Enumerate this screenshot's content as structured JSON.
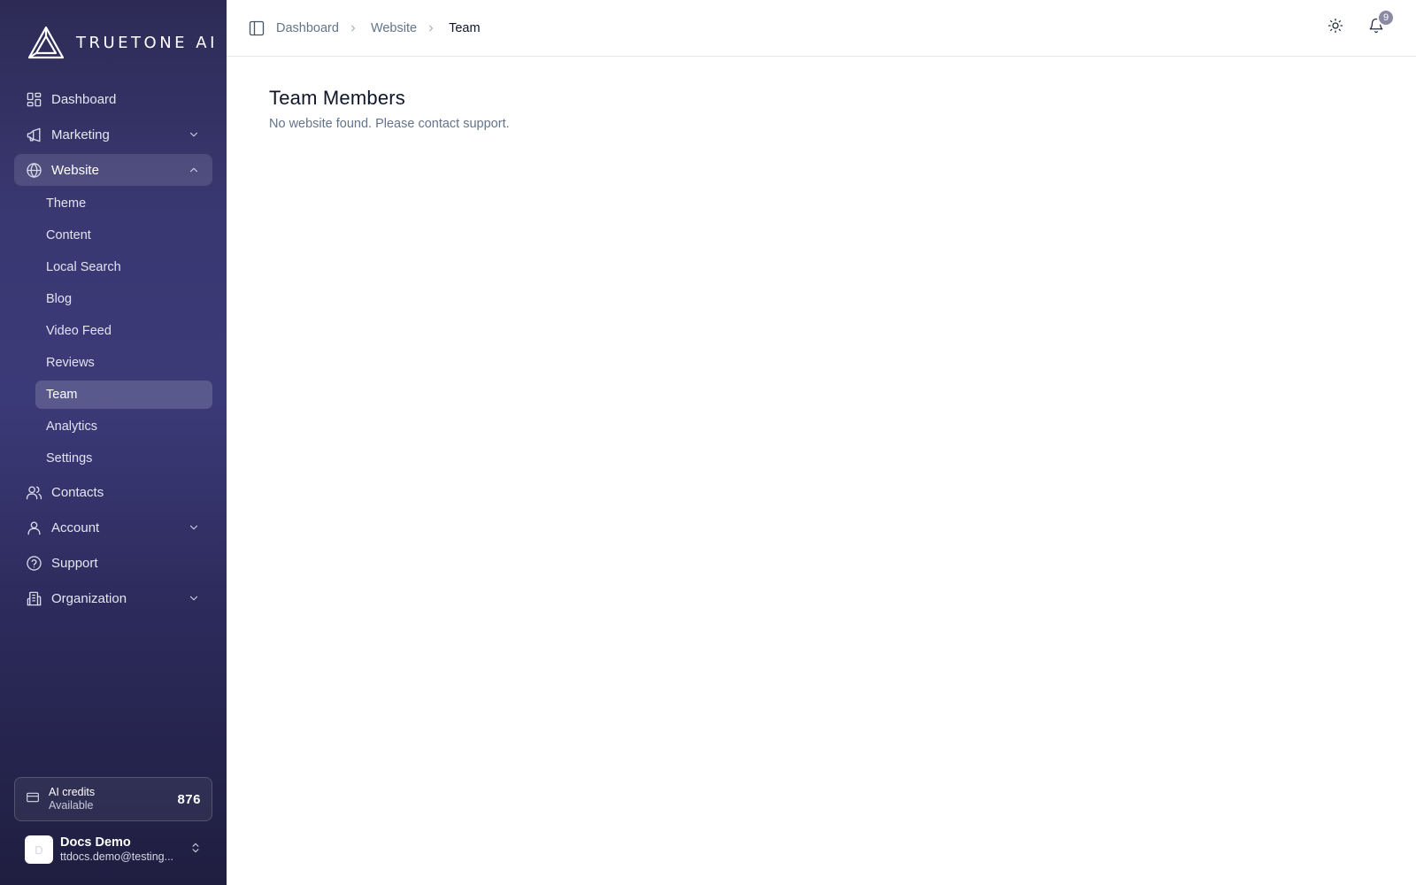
{
  "brand": {
    "name": "TRUETONE AI",
    "logo_icon": "truetone-logo-icon"
  },
  "sidebar": {
    "items": [
      {
        "label": "Dashboard",
        "icon": "dashboard-icon"
      },
      {
        "label": "Marketing",
        "icon": "megaphone-icon",
        "expandable": true,
        "expanded": false
      },
      {
        "label": "Website",
        "icon": "globe-icon",
        "expandable": true,
        "expanded": true,
        "active": true
      },
      {
        "label": "Contacts",
        "icon": "users-icon"
      },
      {
        "label": "Account",
        "icon": "user-icon",
        "expandable": true,
        "expanded": false
      },
      {
        "label": "Support",
        "icon": "help-circle-icon"
      },
      {
        "label": "Organization",
        "icon": "building-icon",
        "expandable": true,
        "expanded": false
      }
    ],
    "website_sub": [
      {
        "label": "Theme"
      },
      {
        "label": "Content"
      },
      {
        "label": "Local Search"
      },
      {
        "label": "Blog"
      },
      {
        "label": "Video Feed"
      },
      {
        "label": "Reviews"
      },
      {
        "label": "Team",
        "active": true
      },
      {
        "label": "Analytics"
      },
      {
        "label": "Settings"
      }
    ],
    "credits": {
      "title": "AI credits",
      "subtitle": "Available",
      "value": "876"
    },
    "user": {
      "name": "Docs Demo",
      "email": "ttdocs.demo@testing...",
      "avatar_initial": "D"
    }
  },
  "topbar": {
    "breadcrumb": [
      "Dashboard",
      "Website",
      "Team"
    ],
    "notifications_count": "9"
  },
  "main": {
    "title": "Team Members",
    "message": "No website found. Please contact support."
  },
  "colors": {
    "sidebar_top": "#2d2b55",
    "sidebar_mid": "#3b3a78",
    "sidebar_bottom": "#1f1e40",
    "badge": "#8b8aa3"
  }
}
